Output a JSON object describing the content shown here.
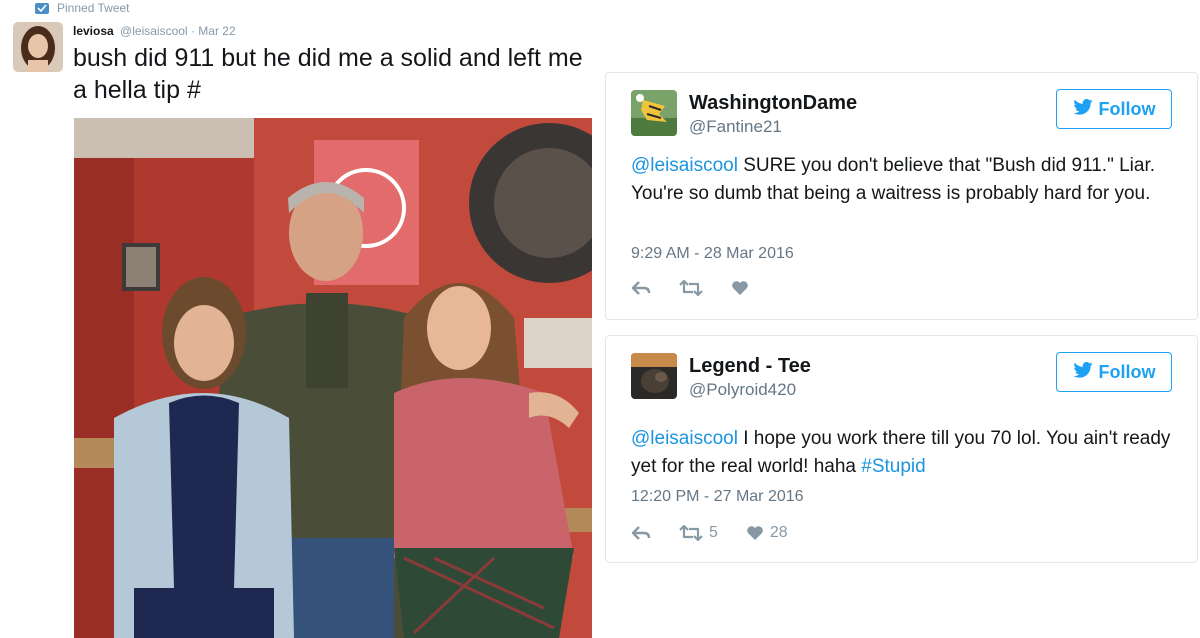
{
  "pinned": {
    "header_label": "Pinned Tweet",
    "name": "leviosa",
    "handle": "@leisaiscool",
    "date": "Mar 22",
    "text": "bush did 911 but he did me a solid and left me a hella tip #"
  },
  "replies": [
    {
      "display_name": "WashingtonDame",
      "handle": "@Fantine21",
      "follow_label": "Follow",
      "mention": "@leisaiscool",
      "text": " SURE you don't believe that \"Bush did 911.\" Liar. You're so dumb that being a waitress is probably hard for you.",
      "timestamp": "9:29 AM - 28 Mar 2016"
    },
    {
      "display_name": "Legend - Tee",
      "handle": "@Polyroid420",
      "follow_label": "Follow",
      "mention": "@leisaiscool",
      "text": " I hope you work there till you 70 lol. You ain't ready yet for the real world! haha ",
      "hashtag": "#Stupid",
      "timestamp": "12:20 PM - 27 Mar 2016",
      "retweet_count": "5",
      "like_count": "28"
    }
  ],
  "colors": {
    "accent": "#1da1f2",
    "link": "#1b95e0",
    "muted": "#657786",
    "border": "#e1e8ed"
  },
  "icons": {
    "reply": "reply-icon",
    "retweet": "retweet-icon",
    "like": "heart-icon",
    "follow": "twitter-bird-icon",
    "pin": "pin-icon"
  }
}
